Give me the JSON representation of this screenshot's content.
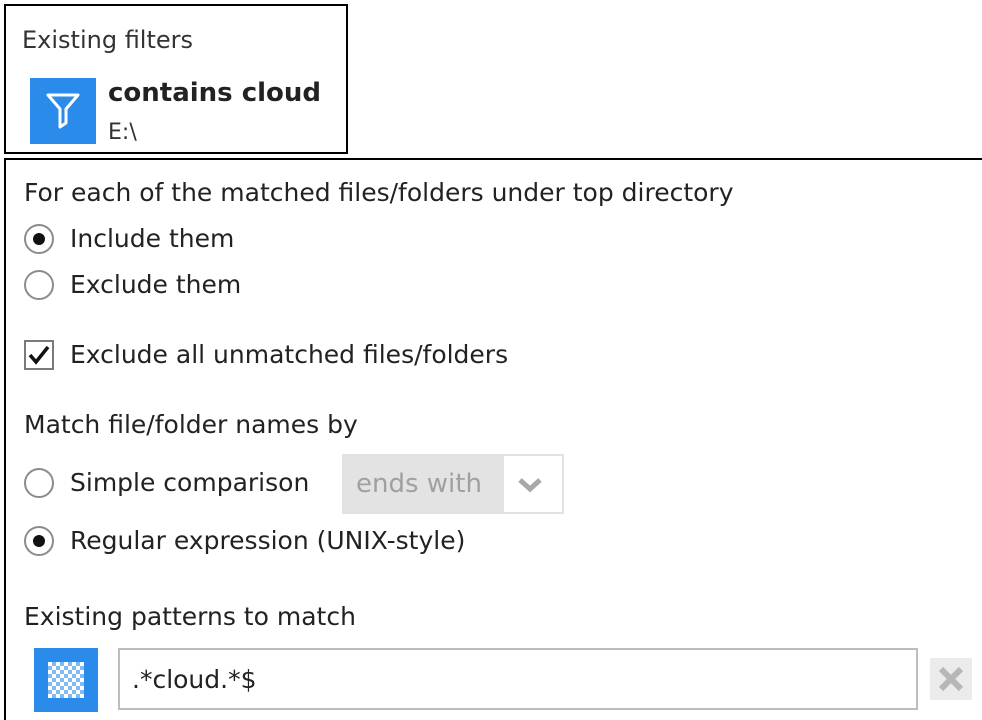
{
  "existing_filters": {
    "heading": "Existing filters",
    "item": {
      "name": "contains cloud",
      "path": "E:\\",
      "icon": "filter-funnel-icon"
    }
  },
  "options": {
    "matched_heading": "For each of the matched files/folders under top directory",
    "include_label": "Include them",
    "exclude_label": "Exclude them",
    "selected": "include",
    "exclude_unmatched_label": "Exclude all unmatched files/folders",
    "exclude_unmatched_checked": true
  },
  "match_by": {
    "heading": "Match file/folder names by",
    "simple_label": "Simple comparison",
    "simple_select_value": "ends with",
    "regex_label": "Regular expression (UNIX-style)",
    "selected": "regex"
  },
  "patterns": {
    "heading": "Existing patterns to match",
    "value": ".*cloud.*$",
    "pattern_icon": "checker-pattern-icon",
    "delete_icon": "x-icon"
  },
  "colors": {
    "accent": "#2b8bea",
    "disabled_bg": "#e3e3e3",
    "disabled_text": "#a0a0a0"
  }
}
